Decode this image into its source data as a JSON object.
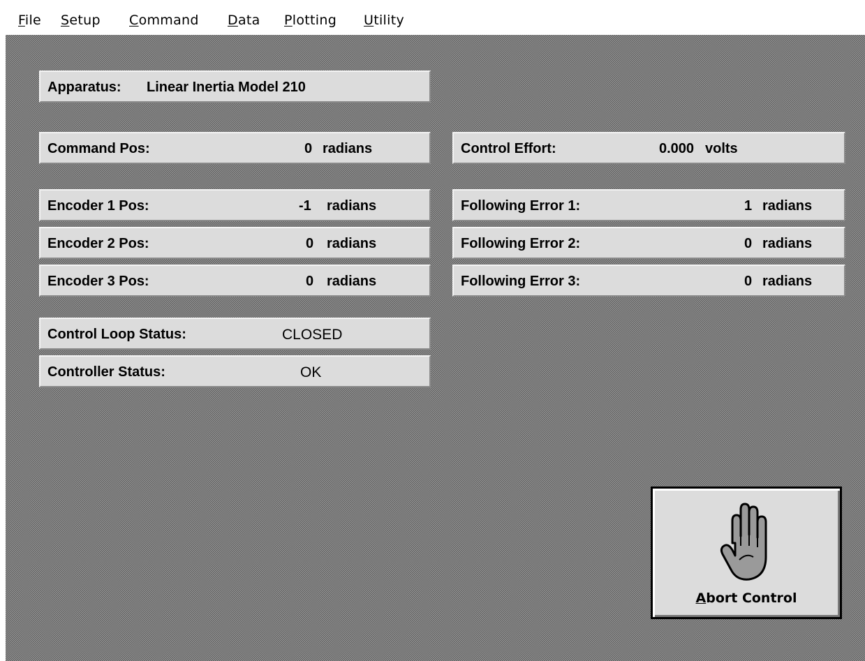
{
  "menu": {
    "items": [
      {
        "label": "File",
        "mnemonic": "F",
        "rest": "ile"
      },
      {
        "label": "Setup",
        "mnemonic": "S",
        "rest": "etup"
      },
      {
        "label": "Command",
        "mnemonic": "C",
        "rest": "ommand"
      },
      {
        "label": "Data",
        "mnemonic": "D",
        "rest": "ata"
      },
      {
        "label": "Plotting",
        "mnemonic": "P",
        "rest": "lotting"
      },
      {
        "label": "Utility",
        "mnemonic": "U",
        "rest": "tility"
      }
    ]
  },
  "apparatus": {
    "label": "Apparatus:",
    "value": "Linear Inertia Model 210"
  },
  "command_pos": {
    "label": "Command Pos:",
    "value": "0",
    "unit": "radians"
  },
  "control_effort": {
    "label": "Control Effort:",
    "value": "0.000",
    "unit": "volts"
  },
  "encoders": [
    {
      "label": "Encoder 1 Pos:",
      "value": "-1",
      "unit": "radians"
    },
    {
      "label": "Encoder 2 Pos:",
      "value": "0",
      "unit": "radians"
    },
    {
      "label": "Encoder 3 Pos:",
      "value": "0",
      "unit": "radians"
    }
  ],
  "following_errors": [
    {
      "label": "Following Error 1:",
      "value": "1",
      "unit": "radians"
    },
    {
      "label": "Following Error 2:",
      "value": "0",
      "unit": "radians"
    },
    {
      "label": "Following Error 3:",
      "value": "0",
      "unit": "radians"
    }
  ],
  "control_loop_status": {
    "label": "Control Loop Status:",
    "value": "CLOSED"
  },
  "controller_status": {
    "label": "Controller Status:",
    "value": "OK"
  },
  "abort_button": {
    "mnemonic": "A",
    "rest": "bort Control",
    "icon": "hand-stop-icon"
  },
  "colors": {
    "panel": "#dcdcdc",
    "background_dither": "#7a7a7a"
  }
}
